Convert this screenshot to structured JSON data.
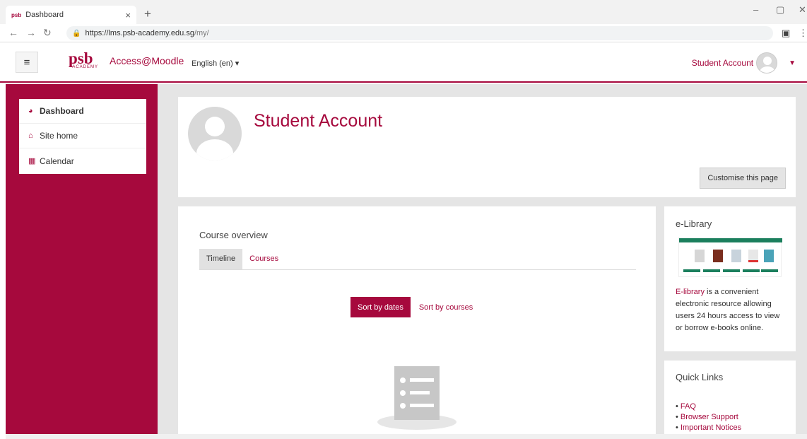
{
  "browser": {
    "tab_title": "Dashboard",
    "tab_close": "×",
    "new_tab": "+",
    "url_host": "https://lms.psb-academy.edu.sg",
    "url_path": "/my/"
  },
  "header": {
    "logo_text": "psb",
    "logo_sub": "ACADEMY",
    "site_name": "Access@Moodle",
    "language": "English (en) ▾",
    "user_name": "Student Account"
  },
  "sidebar": {
    "items": [
      {
        "label": "Dashboard",
        "icon": "dashboard-icon"
      },
      {
        "label": "Site home",
        "icon": "home-icon"
      },
      {
        "label": "Calendar",
        "icon": "calendar-icon"
      }
    ]
  },
  "profile": {
    "name": "Student Account",
    "customise_label": "Customise this page"
  },
  "course_overview": {
    "title": "Course overview",
    "tabs": [
      "Timeline",
      "Courses"
    ],
    "sort_dates": "Sort by dates",
    "sort_courses": "Sort by courses"
  },
  "elibrary": {
    "title": "e-Library",
    "link_text": "E-library",
    "text": " is a convenient electronic resource allowing users 24 hours access to view or borrow e-books online."
  },
  "quick_links": {
    "title": "Quick Links",
    "items": [
      "FAQ",
      "Browser Support",
      "Important Notices"
    ]
  },
  "colors": {
    "brand": "#a6093d",
    "background": "#e5e5e5"
  }
}
